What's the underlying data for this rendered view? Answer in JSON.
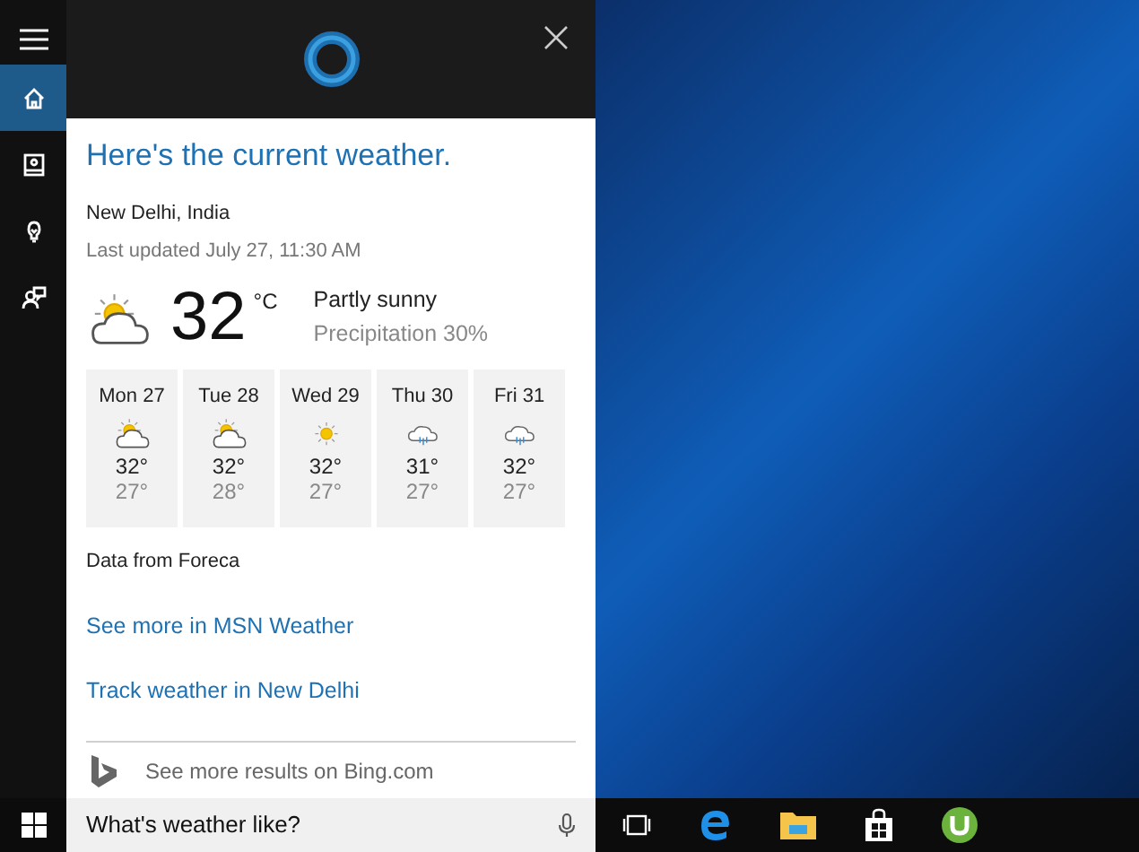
{
  "sidebar": {
    "items": [
      {
        "kind": "home",
        "selected": true
      },
      {
        "kind": "notebook",
        "selected": false
      },
      {
        "kind": "interests",
        "selected": false
      },
      {
        "kind": "feedback",
        "selected": false
      }
    ]
  },
  "card": {
    "heading": "Here's the current weather.",
    "location": "New Delhi, India",
    "updated": "Last updated July 27, 11:30 AM",
    "current": {
      "kind": "partly-sunny",
      "temp": "32",
      "unit": "°C",
      "condition": "Partly sunny",
      "precipitation": "Precipitation 30%"
    },
    "forecast": [
      {
        "day": "Mon 27",
        "kind": "partly-sunny",
        "high": "32°",
        "low": "27°"
      },
      {
        "day": "Tue 28",
        "kind": "partly-sunny",
        "high": "32°",
        "low": "28°"
      },
      {
        "day": "Wed 29",
        "kind": "sunny",
        "high": "32°",
        "low": "27°"
      },
      {
        "day": "Thu 30",
        "kind": "rain",
        "high": "31°",
        "low": "27°"
      },
      {
        "day": "Fri 31",
        "kind": "rain",
        "high": "32°",
        "low": "27°"
      }
    ],
    "source": "Data from Foreca",
    "links": [
      "See more in MSN Weather",
      "Track weather in New Delhi"
    ],
    "bing": "See more results on Bing.com"
  },
  "search": {
    "value": "What's weather like?"
  },
  "taskbar": {
    "apps": [
      {
        "kind": "task-view"
      },
      {
        "kind": "edge"
      },
      {
        "kind": "explorer"
      },
      {
        "kind": "store"
      },
      {
        "kind": "torrent"
      }
    ]
  }
}
